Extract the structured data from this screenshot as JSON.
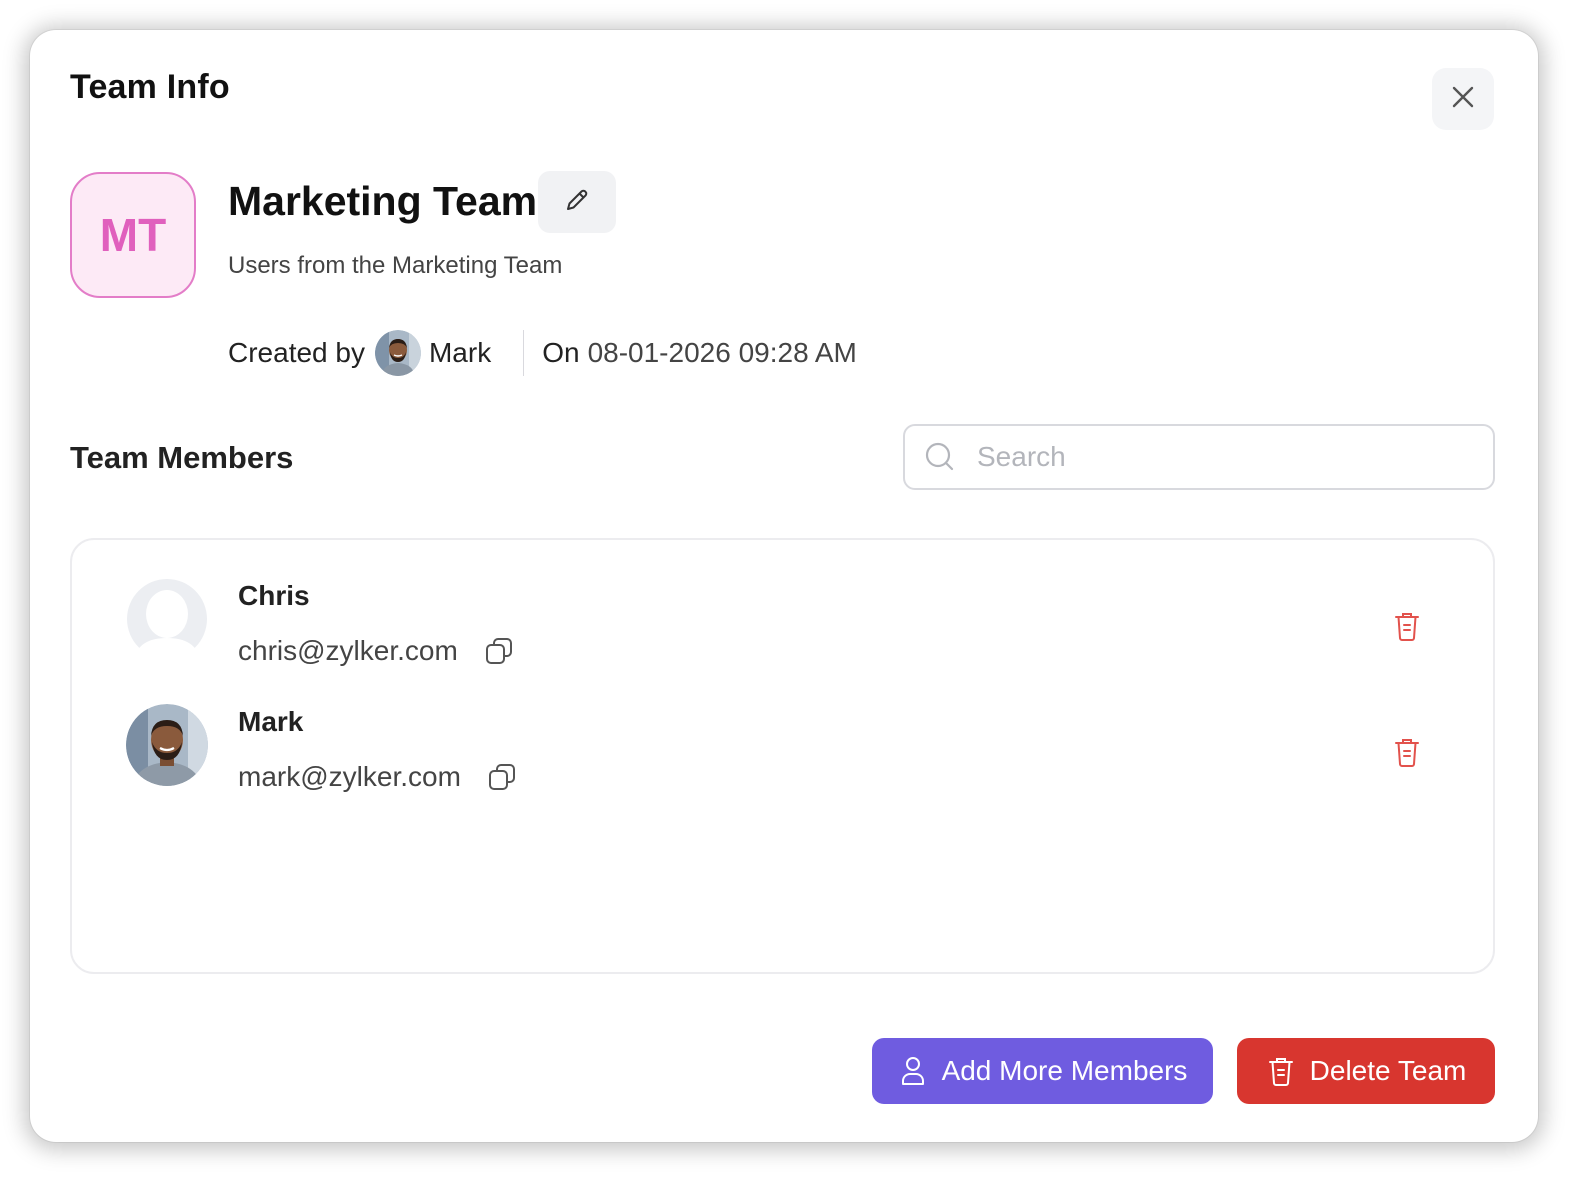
{
  "modal": {
    "title": "Team Info",
    "close_icon": "close-icon"
  },
  "team": {
    "initials": "MT",
    "name": "Marketing Team",
    "description": "Users from the Marketing Team",
    "edit_icon": "pencil-icon",
    "avatar_colors": {
      "background": "#fdeaf6",
      "border": "#e37dc8",
      "text": "#e060bd"
    }
  },
  "created": {
    "label": "Created by",
    "creator_name": "Mark",
    "on_label": "On",
    "datetime": "08-01-2026 09:28 AM"
  },
  "members_section": {
    "title": "Team Members",
    "search_placeholder": "Search",
    "search_value": ""
  },
  "members": [
    {
      "name": "Chris",
      "email": "chris@zylker.com",
      "avatar": "default-user-avatar"
    },
    {
      "name": "Mark",
      "email": "mark@zylker.com",
      "avatar": "photo-avatar"
    }
  ],
  "actions": {
    "add_label": "Add More Members",
    "delete_label": "Delete Team",
    "add_color": "#6f5ce0",
    "delete_color": "#d8362f"
  }
}
